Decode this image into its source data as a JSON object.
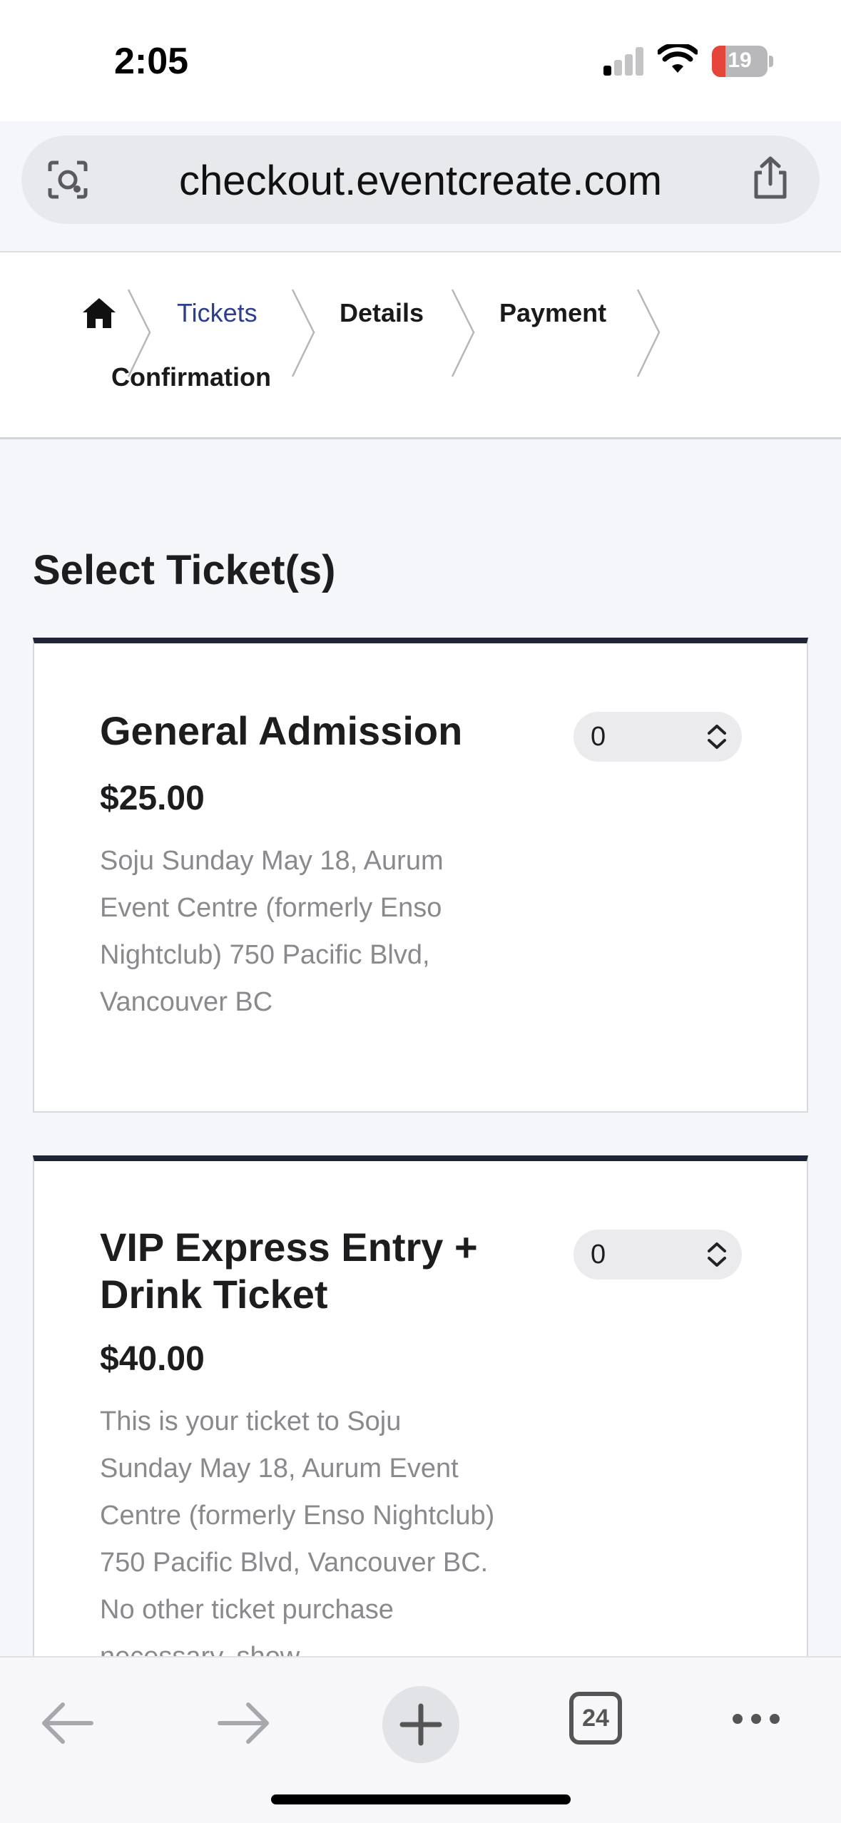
{
  "status_bar": {
    "time": "2:05",
    "battery": "19"
  },
  "browser": {
    "url": "checkout.eventcreate.com",
    "tab_count": "24"
  },
  "breadcrumb": {
    "items": [
      {
        "label": "Tickets",
        "active": true
      },
      {
        "label": "Details",
        "active": false
      },
      {
        "label": "Payment",
        "active": false
      },
      {
        "label": "Confirmation",
        "active": false
      }
    ]
  },
  "main": {
    "title": "Select Ticket(s)",
    "tickets": [
      {
        "name": "General Admission",
        "price": "$25.00",
        "quantity": "0",
        "description": "Soju Sunday May 18, Aurum Event Centre (formerly Enso Nightclub) 750 Pacific Blvd, Vancouver BC"
      },
      {
        "name": "VIP Express Entry + Drink Ticket",
        "price": "$40.00",
        "quantity": "0",
        "description": "This is your ticket to Soju Sunday May 18, Aurum Event Centre (formerly Enso Nightclub) 750 Pacific Blvd, Vancouver BC. No other ticket purchase necessary, show"
      }
    ]
  },
  "colors": {
    "active_crumb": "#2d3d8f",
    "card_top_border": "#1f2436",
    "description_text": "#8a8a8e"
  }
}
